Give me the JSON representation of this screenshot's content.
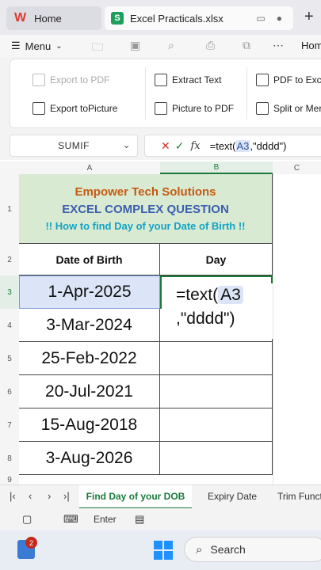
{
  "tabs": {
    "home_label": "Home",
    "file_label": "Excel Practicals.xlsx",
    "home_logo": "W",
    "file_logo": "S"
  },
  "menu": {
    "menu_label": "Menu",
    "home_label": "Hom"
  },
  "ribbon": {
    "export_pdf": "Export to PDF",
    "export_picture": "Export toPicture",
    "extract_text": "Extract Text",
    "picture_to_pdf": "Picture to PDF",
    "pdf_to_excel": "PDF to Exce",
    "split_or_merge": "Split or Mer"
  },
  "formula_bar": {
    "name_box": "SUMIF",
    "fx_label": "fx",
    "formula_prefix": "=text(",
    "formula_ref": "A3",
    "formula_suffix": ",\"dddd\")"
  },
  "sheet": {
    "columns": [
      "A",
      "B",
      "C"
    ],
    "rows": [
      "1",
      "2",
      "3",
      "4",
      "5",
      "6",
      "7",
      "8",
      "9"
    ],
    "banner": {
      "line1": "Empower Tech Solutions",
      "line2": "EXCEL COMPLEX QUESTION",
      "line3": "!! How to find Day of your Date of Birth !!",
      "bg_color": "#d9ead3",
      "line1_color": "#c55a11",
      "line2_color": "#3a5fb0",
      "line3_color": "#12a3c4"
    },
    "header_date": "Date of Birth",
    "header_day": "Day",
    "dates": [
      "1-Apr-2025",
      "3-Mar-2024",
      "25-Feb-2022",
      "20-Jul-2021",
      "15-Aug-2018",
      "3-Aug-2026"
    ],
    "editing_prefix": "=text(",
    "editing_ref": "A3",
    "editing_suffix": ",\"dddd\")",
    "selected_color": "#dbe5f7"
  },
  "sheet_tabs": {
    "active": "Find Day of your DOB",
    "tab2": "Expiry Date",
    "tab3": "Trim Functi"
  },
  "bottom_tools": {
    "enter_label": "Enter"
  },
  "taskbar": {
    "search_label": "Search",
    "badge_count": "2"
  }
}
